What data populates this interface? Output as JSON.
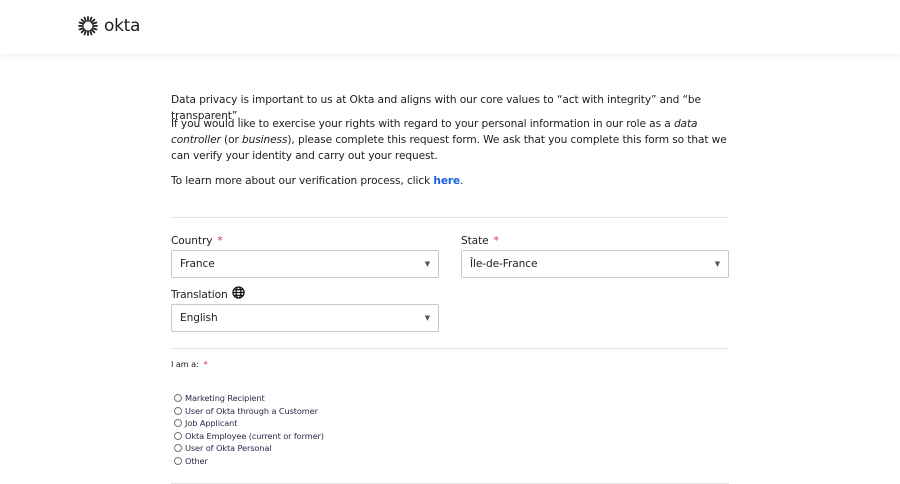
{
  "header": {
    "logo_text": "okta"
  },
  "intro": {
    "p1": "Data privacy is important to us at Okta and aligns with our core values to “act with integrity” and “be transparent”.",
    "p2_a": "If you would like to exercise your rights with regard to your personal information in our role as a ",
    "p2_em1": "data controller",
    "p2_b": " (or ",
    "p2_em2": "business",
    "p2_c": "), please complete this request form. We ask that you complete this form so that we can verify your identity and carry out your request.",
    "p3_a": "To learn more about our verification process, click ",
    "p3_link": "here",
    "p3_b": "."
  },
  "form": {
    "country_label": "Country",
    "country_value": "France",
    "state_label": "State",
    "state_value": "Île-de-France",
    "translation_label": "Translation",
    "translation_value": "English",
    "required_mark": "*",
    "iam_label": "I am a:",
    "options": [
      "Marketing Recipient",
      "User of Okta through a Customer",
      "Job Applicant",
      "Okta Employee (current or former)",
      "User of Okta Personal",
      "Other"
    ]
  }
}
